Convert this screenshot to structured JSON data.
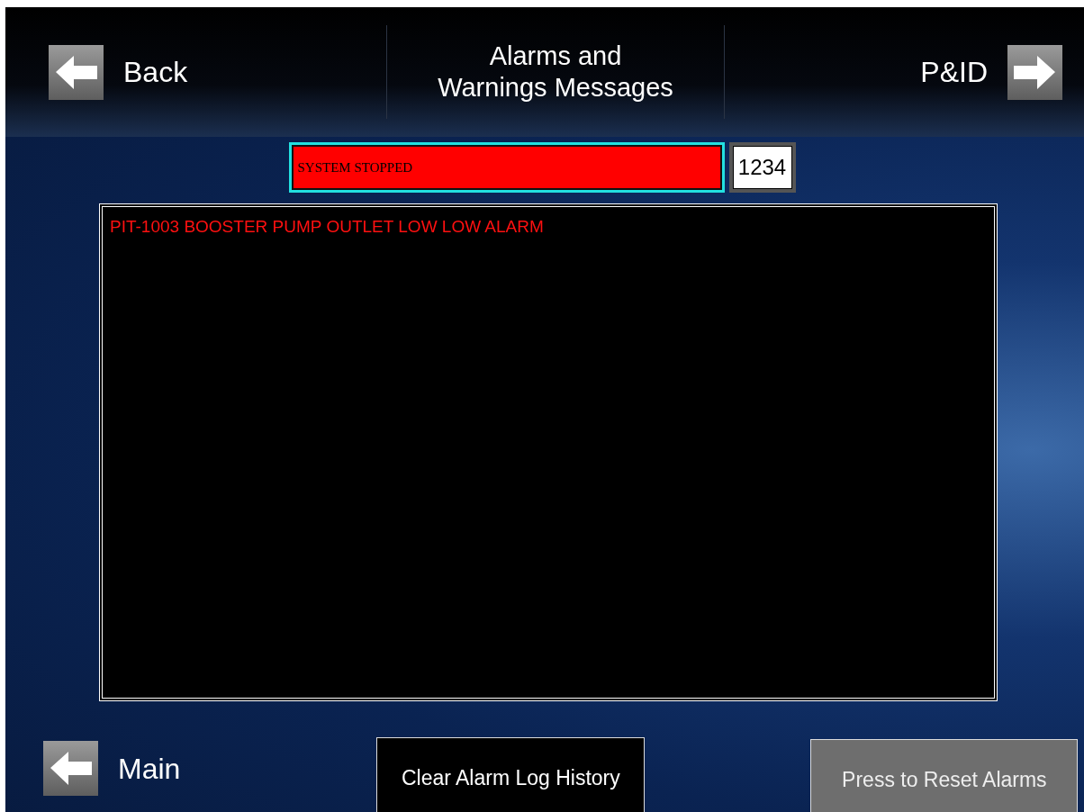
{
  "header": {
    "back": {
      "label": "Back"
    },
    "title": "Alarms and\nWarnings Messages",
    "forward": {
      "label": "P&ID"
    }
  },
  "status": {
    "message": "SYSTEM STOPPED",
    "counter": "1234"
  },
  "log": {
    "messages": [
      {
        "text": "PIT-1003 BOOSTER PUMP OUTLET LOW LOW ALARM"
      }
    ]
  },
  "footer": {
    "main": {
      "label": "Main"
    },
    "buttons": [
      {
        "label": "Clear Alarm Log History",
        "kind": "action"
      },
      {
        "label": "Press to Reset Alarms",
        "kind": "muted"
      }
    ]
  }
}
